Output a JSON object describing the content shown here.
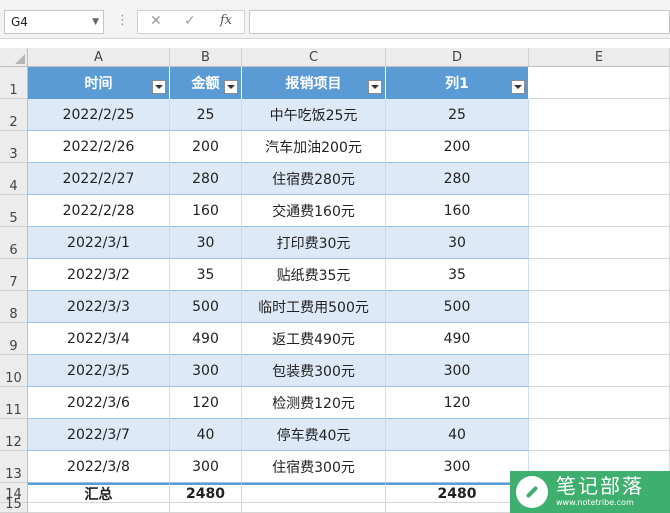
{
  "namebox": "G4",
  "formula_bar": {
    "cancel_glyph": "✕",
    "enter_glyph": "✓",
    "fx_label": "fx",
    "content": ""
  },
  "columns": [
    "A",
    "B",
    "C",
    "D",
    "E"
  ],
  "rows": [
    "1",
    "2",
    "3",
    "4",
    "5",
    "6",
    "7",
    "8",
    "9",
    "10",
    "11",
    "12",
    "13",
    "14",
    "15"
  ],
  "table": {
    "headers": [
      "时间",
      "金额",
      "报销项目",
      "列1"
    ],
    "records": [
      [
        "2022/2/25",
        "25",
        "中午吃饭25元",
        "25"
      ],
      [
        "2022/2/26",
        "200",
        "汽车加油200元",
        "200"
      ],
      [
        "2022/2/27",
        "280",
        "住宿费280元",
        "280"
      ],
      [
        "2022/2/28",
        "160",
        "交通费160元",
        "160"
      ],
      [
        "2022/3/1",
        "30",
        "打印费30元",
        "30"
      ],
      [
        "2022/3/2",
        "35",
        "贴纸费35元",
        "35"
      ],
      [
        "2022/3/3",
        "500",
        "临时工费用500元",
        "500"
      ],
      [
        "2022/3/4",
        "490",
        "返工费490元",
        "490"
      ],
      [
        "2022/3/5",
        "300",
        "包装费300元",
        "300"
      ],
      [
        "2022/3/6",
        "120",
        "检测费120元",
        "120"
      ],
      [
        "2022/3/7",
        "40",
        "停车费40元",
        "40"
      ],
      [
        "2022/3/8",
        "300",
        "住宿费300元",
        "300"
      ]
    ],
    "total_row": [
      "汇总",
      "2480",
      "",
      "2480"
    ]
  },
  "watermark": {
    "title": "笔记部落",
    "url": "www.notetribe.com"
  },
  "colors": {
    "header_fill": "#5b9bd5",
    "band_fill": "#dde9f7",
    "watermark_green": "#3eaf6e"
  }
}
